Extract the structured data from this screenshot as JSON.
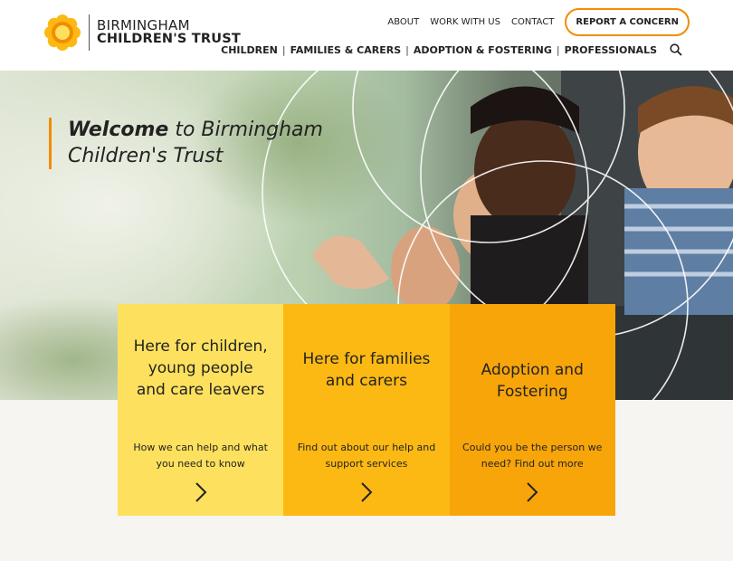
{
  "header": {
    "logo": {
      "line1": "BIRMINGHAM",
      "line2": "CHILDREN'S TRUST"
    },
    "top_links": [
      "ABOUT",
      "WORK WITH US",
      "CONTACT"
    ],
    "report_button": "REPORT A CONCERN",
    "main_nav": [
      "CHILDREN",
      "FAMILIES & CARERS",
      "ADOPTION & FOSTERING",
      "PROFESSIONALS"
    ],
    "search_icon": "search-icon"
  },
  "hero": {
    "welcome_bold": "Welcome",
    "welcome_rest": " to Birmingham",
    "welcome_line2": "Children's Trust"
  },
  "tiles": [
    {
      "title": "Here for children, young people and care leavers",
      "desc": "How we can help and what you need to know",
      "icon": "chevron-right-icon",
      "color": "#fde15e"
    },
    {
      "title": "Here for families and carers",
      "desc": "Find out about our help and support services",
      "icon": "chevron-right-icon",
      "color": "#fdb913"
    },
    {
      "title": "Adoption and Fostering",
      "desc": "Could you be the person we need? Find out more",
      "icon": "chevron-right-icon",
      "color": "#f8a50a"
    }
  ],
  "colors": {
    "accent": "#f28c00",
    "page_bg": "#f6f5f2"
  }
}
